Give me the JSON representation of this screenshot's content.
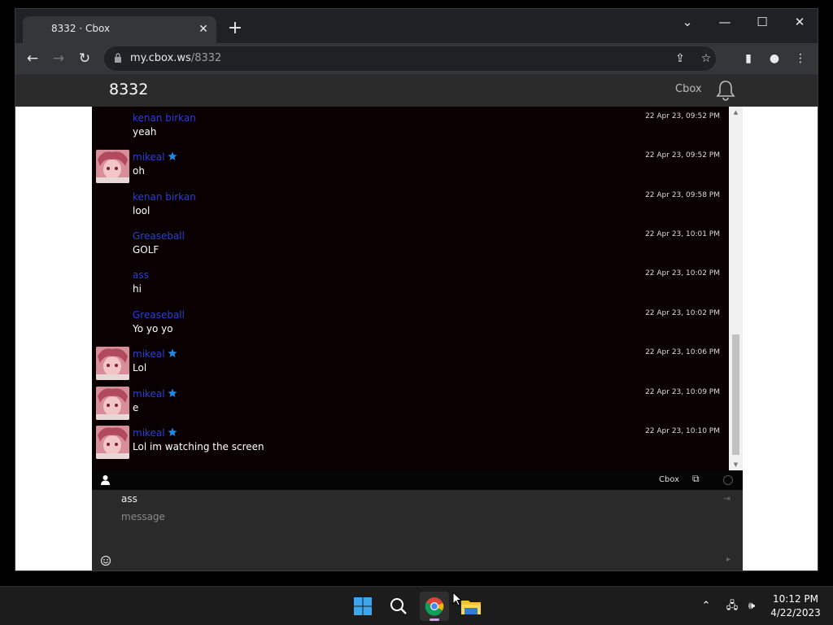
{
  "browser": {
    "tab_title": "8332 · Cbox",
    "url_domain": "my.cbox.ws",
    "url_path": "/8332"
  },
  "cbox": {
    "room_title": "8332",
    "brand": "Cbox",
    "status_link": "Cbox"
  },
  "messages": [
    {
      "user": "kenan birkan",
      "text": "yeah",
      "time": "22 Apr 23, 09:52 PM",
      "avatar": false,
      "star": false
    },
    {
      "user": "mikeal",
      "text": "oh",
      "time": "22 Apr 23, 09:52 PM",
      "avatar": true,
      "star": true
    },
    {
      "user": "kenan birkan",
      "text": "lool",
      "time": "22 Apr 23, 09:58 PM",
      "avatar": false,
      "star": false
    },
    {
      "user": "Greaseball",
      "text": "GOLF",
      "time": "22 Apr 23, 10:01 PM",
      "avatar": false,
      "star": false
    },
    {
      "user": "ass",
      "text": "hi",
      "time": "22 Apr 23, 10:02 PM",
      "avatar": false,
      "star": false
    },
    {
      "user": "Greaseball",
      "text": "Yo yo yo",
      "time": "22 Apr 23, 10:02 PM",
      "avatar": false,
      "star": false
    },
    {
      "user": "mikeal",
      "text": "Lol",
      "time": "22 Apr 23, 10:06 PM",
      "avatar": true,
      "star": true
    },
    {
      "user": "mikeal",
      "text": "e",
      "time": "22 Apr 23, 10:09 PM",
      "avatar": true,
      "star": true
    },
    {
      "user": "mikeal",
      "text": "Lol im watching the screen",
      "time": "22 Apr 23, 10:10 PM",
      "avatar": true,
      "star": true
    }
  ],
  "composer": {
    "name_value": "ass",
    "message_placeholder": "message"
  },
  "taskbar": {
    "time": "10:12 PM",
    "date": "4/22/2023"
  },
  "colors": {
    "username": "#2b3fd6",
    "star": "#1e88e5",
    "chat_bg": "#0a0002"
  }
}
